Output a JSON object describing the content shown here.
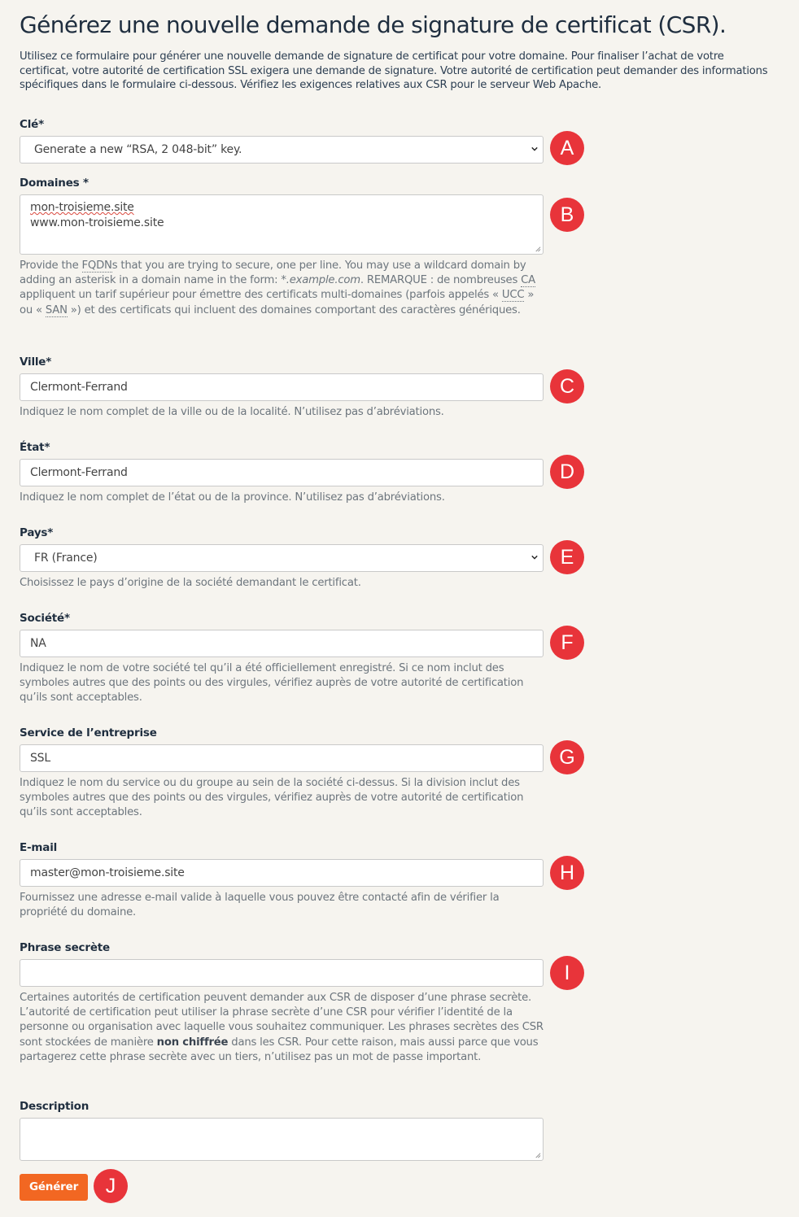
{
  "title": "Générez une nouvelle demande de signature de certificat (CSR).",
  "intro": "Utilisez ce formulaire pour générer une nouvelle demande de signature de certificat pour votre domaine. Pour finaliser l’achat de votre certificat, votre autorité de certification SSL exigera une demande de signature. Votre autorité de certification peut demander des informations spécifiques dans le formulaire ci-dessous. Vérifiez les exigences relatives aux CSR pour le serveur Web Apache.",
  "key": {
    "label": "Clé*",
    "value": "Generate a new “RSA, 2 048-bit” key.",
    "marker": "A"
  },
  "domains": {
    "label": "Domaines *",
    "lines": [
      "mon-troisieme.site",
      "www.mon-troisieme.site"
    ],
    "marker": "B",
    "help": {
      "t1": "Provide the ",
      "fqdn": "FQDN",
      "t2": "s that you are trying to secure, one per line. You may use a wildcard domain by adding an asterisk in a domain name in the form: ",
      "example": "*.example.com",
      "t3": ". REMARQUE : de nombreuses ",
      "ca": "CA",
      "t4": " appliquent un tarif supérieur pour émettre des certificats multi-domaines (parfois appelés « ",
      "ucc": "UCC",
      "t5": " » ou « ",
      "san": "SAN",
      "t6": " ») et des certificats qui incluent des domaines comportant des caractères génériques."
    }
  },
  "city": {
    "label": "Ville*",
    "value": "Clermont-Ferrand",
    "marker": "C",
    "help": "Indiquez le nom complet de la ville ou de la localité. N’utilisez pas d’abréviations."
  },
  "state": {
    "label": "État*",
    "value": "Clermont-Ferrand",
    "marker": "D",
    "help": "Indiquez le nom complet de l’état ou de la province. N’utilisez pas d’abréviations."
  },
  "country": {
    "label": "Pays*",
    "value": "FR (France)",
    "marker": "E",
    "help": "Choisissez le pays d’origine de la société demandant le certificat."
  },
  "company": {
    "label": "Société*",
    "value": "NA",
    "marker": "F",
    "help": "Indiquez le nom de votre société tel qu’il a été officiellement enregistré. Si ce nom inclut des symboles autres que des points ou des virgules, vérifiez auprès de votre autorité de certification qu’ils sont acceptables."
  },
  "department": {
    "label": "Service de l’entreprise",
    "value": "SSL",
    "marker": "G",
    "help": "Indiquez le nom du service ou du groupe au sein de la société ci-dessus. Si la division inclut des symboles autres que des points ou des virgules, vérifiez auprès de votre autorité de certification qu’ils sont acceptables."
  },
  "email": {
    "label": "E-mail",
    "value": "master@mon-troisieme.site",
    "marker": "H",
    "help": "Fournissez une adresse e-mail valide à laquelle vous pouvez être contacté afin de vérifier la propriété du domaine."
  },
  "passphrase": {
    "label": "Phrase secrète",
    "value": "",
    "marker": "I",
    "help_before": "Certaines autorités de certification peuvent demander aux CSR de disposer d’une phrase secrète. L’autorité de certification peut utiliser la phrase secrète d’une CSR pour vérifier l’identité de la personne ou organisation avec laquelle vous souhaitez communiquer. Les phrases secrètes des CSR sont stockées de manière ",
    "help_bold": "non chiffrée",
    "help_after": " dans les CSR. Pour cette raison, mais aussi parce que vous partagerez cette phrase secrète avec un tiers, n’utilisez pas un mot de passe important."
  },
  "description": {
    "label": "Description",
    "value": ""
  },
  "generate": {
    "label": "Générer",
    "marker": "J"
  },
  "colors": {
    "accent": "#f26722",
    "marker": "#e8343a",
    "background": "#f6f4ef"
  },
  "icons": {
    "select": "chevron-down-icon",
    "resize": "resize-grip-icon"
  }
}
